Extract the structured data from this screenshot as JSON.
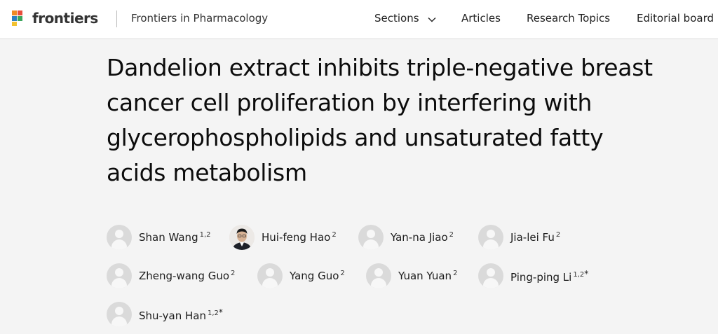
{
  "header": {
    "brand": "frontiers",
    "journal": "Frontiers in Pharmacology",
    "nav": {
      "sections": "Sections",
      "articles": "Articles",
      "research_topics": "Research Topics",
      "editorial_board": "Editorial board"
    },
    "logo_colors": [
      "#f08a24",
      "#e94e3c",
      "#2c7fc2",
      "#3ba55c",
      "#f2c230"
    ]
  },
  "article": {
    "title": "Dandelion extract inhibits triple-negative breast cancer cell proliferation by interfering with glycerophospholipids and unsaturated fatty acids metabolism"
  },
  "authors": [
    {
      "name": "Shan Wang",
      "affiliation": "1,2",
      "corresponding": "",
      "avatar": "placeholder"
    },
    {
      "name": "Hui-feng Hao",
      "affiliation": "2",
      "corresponding": "",
      "avatar": "photo"
    },
    {
      "name": "Yan-na Jiao",
      "affiliation": "2",
      "corresponding": "",
      "avatar": "placeholder"
    },
    {
      "name": "Jia-lei Fu",
      "affiliation": "2",
      "corresponding": "",
      "avatar": "placeholder"
    },
    {
      "name": "Zheng-wang Guo",
      "affiliation": "2",
      "corresponding": "",
      "avatar": "placeholder"
    },
    {
      "name": "Yang Guo",
      "affiliation": "2",
      "corresponding": "",
      "avatar": "placeholder"
    },
    {
      "name": "Yuan Yuan",
      "affiliation": "2",
      "corresponding": "",
      "avatar": "placeholder"
    },
    {
      "name": "Ping-ping Li",
      "affiliation": "1,2",
      "corresponding": "*",
      "avatar": "placeholder"
    },
    {
      "name": "Shu-yan Han",
      "affiliation": "1,2",
      "corresponding": "*",
      "avatar": "placeholder"
    }
  ]
}
